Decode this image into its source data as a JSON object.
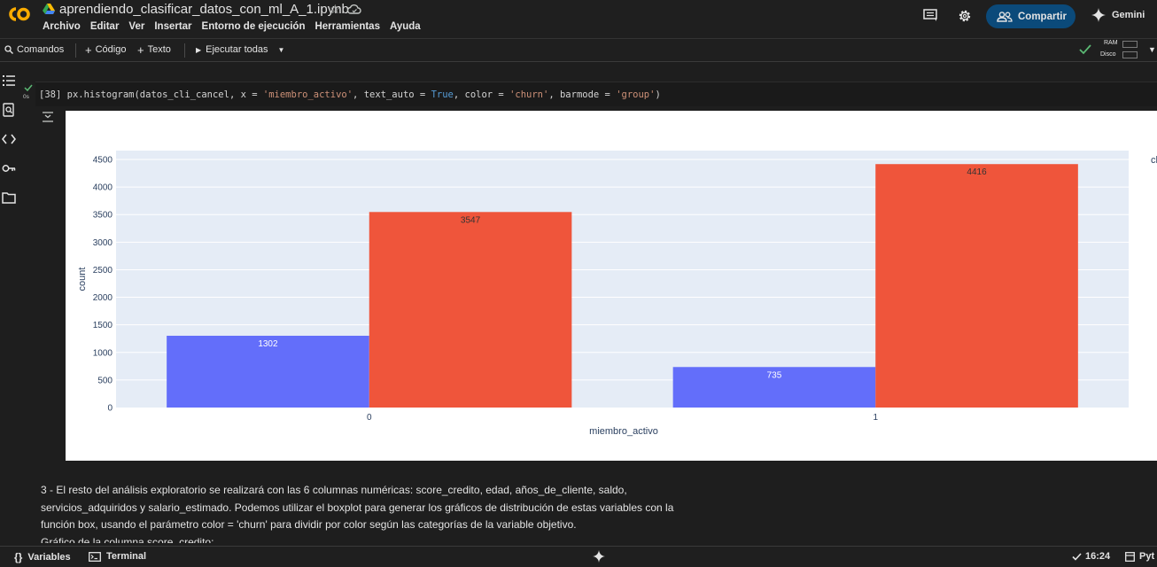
{
  "header": {
    "notebook_title": "aprendiendo_clasificar_datos_con_ml_A_1.ipynb",
    "menu": [
      "Archivo",
      "Editar",
      "Ver",
      "Insertar",
      "Entorno de ejecución",
      "Herramientas",
      "Ayuda"
    ],
    "share_label": "Compartir",
    "gemini_label": "Gemini",
    "brand_color": "#f9ab00"
  },
  "toolbar": {
    "commands_label": "Comandos",
    "code_label": "Código",
    "text_label": "Texto",
    "run_all_label": "Ejecutar todas",
    "ram_label": "RAM",
    "disk_label": "Disco"
  },
  "cell": {
    "exec_count": "[38]",
    "exec_time": "0s",
    "code": {
      "p1": "px.histogram(datos_cli_cancel, x = ",
      "s1": "'miembro_activo'",
      "p2": ", text_auto = ",
      "k1": "True",
      "p3": ", color = ",
      "s2": "'churn'",
      "p4": ", barmode = ",
      "s3": "'group'",
      "p5": ")"
    }
  },
  "chart_data": {
    "type": "bar",
    "barmode": "group",
    "categories": [
      "0",
      "1"
    ],
    "series": [
      {
        "values": [
          1302,
          735
        ],
        "color": "#636efa"
      },
      {
        "values": [
          3547,
          4416
        ],
        "color": "#ef553b"
      }
    ],
    "xlabel": "miembro_activo",
    "ylabel": "count",
    "ylim": [
      0,
      4500
    ],
    "yticks": [
      0,
      500,
      1000,
      1500,
      2000,
      2500,
      3000,
      3500,
      4000,
      4500
    ],
    "legend_title": "ch",
    "grid": true,
    "plot_bg": "#e5ecf6"
  },
  "markdown": {
    "line1": "3 - El resto del análisis exploratorio se realizará con las 6 columnas numéricas: score_credito, edad, años_de_cliente, saldo,",
    "line2": "servicios_adquiridos y salario_estimado. Podemos utilizar el boxplot para generar los gráficos de distribución de estas variables con la",
    "line3": "función box, usando el parámetro color = 'churn' para dividir por color según las categorías de la variable objetivo.",
    "line4": "Gráfico de la columna score_credito:"
  },
  "statusbar": {
    "variables_label": "Variables",
    "terminal_label": "Terminal",
    "time": "16:24",
    "runtime": "Pyt"
  }
}
